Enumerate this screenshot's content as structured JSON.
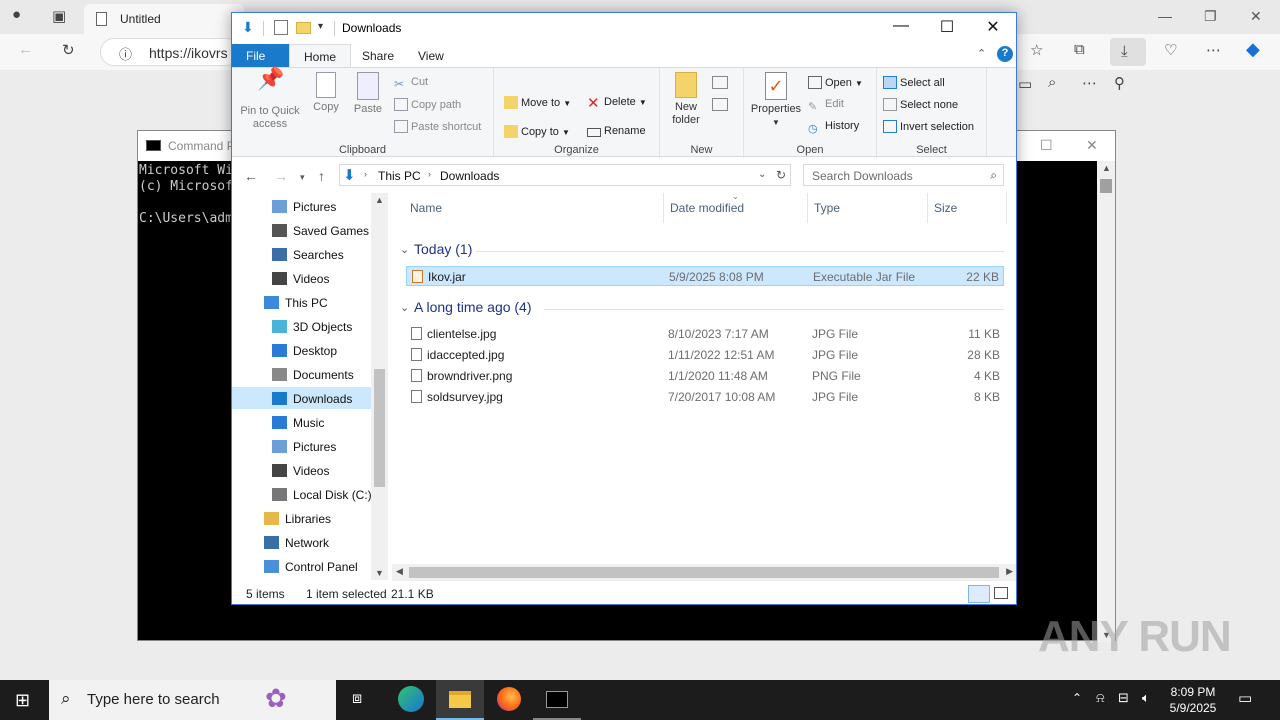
{
  "browser": {
    "tab_title": "Untitled",
    "address": "https://ikovrs"
  },
  "cmd": {
    "title": "Command P",
    "lines": [
      "Microsoft Wi",
      "(c) Microsof",
      "",
      "C:\\Users\\adm"
    ]
  },
  "explorer": {
    "title": "Downloads",
    "ribbon_tabs": [
      "File",
      "Home",
      "Share",
      "View"
    ],
    "clipboard": {
      "label": "Clipboard",
      "pin": "Pin to Quick access",
      "copy": "Copy",
      "paste": "Paste",
      "cut": "Cut",
      "copy_path": "Copy path",
      "paste_shortcut": "Paste shortcut"
    },
    "organize": {
      "label": "Organize",
      "move_to": "Move to",
      "copy_to": "Copy to",
      "delete": "Delete",
      "rename": "Rename"
    },
    "new": {
      "label": "New",
      "new_folder": "New folder"
    },
    "open": {
      "label": "Open",
      "properties": "Properties",
      "open": "Open",
      "edit": "Edit",
      "history": "History"
    },
    "select": {
      "label": "Select",
      "select_all": "Select all",
      "select_none": "Select none",
      "invert": "Invert selection"
    },
    "breadcrumb": [
      "This PC",
      "Downloads"
    ],
    "search_placeholder": "Search Downloads",
    "nav_items": [
      {
        "label": "Pictures",
        "icon": "pictures-icon"
      },
      {
        "label": "Saved Games",
        "icon": "saved-games-icon"
      },
      {
        "label": "Searches",
        "icon": "searches-icon"
      },
      {
        "label": "Videos",
        "icon": "videos-icon"
      },
      {
        "label": "This PC",
        "icon": "this-pc-icon"
      },
      {
        "label": "3D Objects",
        "icon": "3d-objects-icon"
      },
      {
        "label": "Desktop",
        "icon": "desktop-icon"
      },
      {
        "label": "Documents",
        "icon": "documents-icon"
      },
      {
        "label": "Downloads",
        "icon": "downloads-icon"
      },
      {
        "label": "Music",
        "icon": "music-icon"
      },
      {
        "label": "Pictures",
        "icon": "pictures-icon"
      },
      {
        "label": "Videos",
        "icon": "videos-icon"
      },
      {
        "label": "Local Disk (C:)",
        "icon": "drive-icon"
      },
      {
        "label": "Libraries",
        "icon": "libraries-icon"
      },
      {
        "label": "Network",
        "icon": "network-icon"
      },
      {
        "label": "Control Panel",
        "icon": "control-panel-icon"
      }
    ],
    "columns": [
      "Name",
      "Date modified",
      "Type",
      "Size"
    ],
    "groups": [
      {
        "header": "Today (1)",
        "files": [
          {
            "name": "Ikov.jar",
            "date": "5/9/2025 8:08 PM",
            "type": "Executable Jar File",
            "size": "22 KB",
            "selected": true
          }
        ]
      },
      {
        "header": "A long time ago (4)",
        "files": [
          {
            "name": "clientelse.jpg",
            "date": "8/10/2023 7:17 AM",
            "type": "JPG File",
            "size": "11 KB"
          },
          {
            "name": "idaccepted.jpg",
            "date": "1/11/2022 12:51 AM",
            "type": "JPG File",
            "size": "28 KB"
          },
          {
            "name": "browndriver.png",
            "date": "1/1/2020 11:48 AM",
            "type": "PNG File",
            "size": "4 KB"
          },
          {
            "name": "soldsurvey.jpg",
            "date": "7/20/2017 10:08 AM",
            "type": "JPG File",
            "size": "8 KB"
          }
        ]
      }
    ],
    "status": {
      "items": "5 items",
      "selected": "1 item selected",
      "size": "21.1 KB"
    }
  },
  "taskbar": {
    "search_placeholder": "Type here to search",
    "time": "8:09 PM",
    "date": "5/9/2025"
  },
  "watermark": "ANY RUN",
  "colors": {
    "accent": "#1979ca",
    "selection": "#cce8ff",
    "group_header": "#1e3287"
  }
}
